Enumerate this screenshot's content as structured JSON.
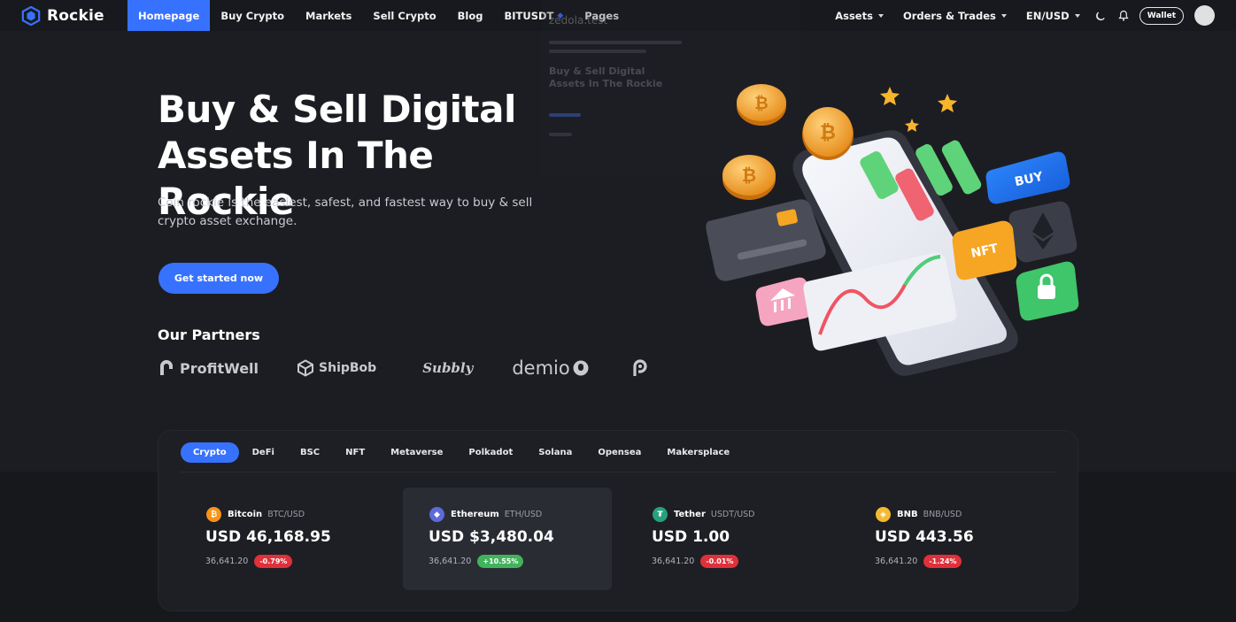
{
  "brand": {
    "name": "Rockie",
    "accent": "#3772ff"
  },
  "nav": {
    "links": [
      "Homepage",
      "Buy Crypto",
      "Markets",
      "Sell Crypto",
      "Blog",
      "BITUSDT",
      "Pages"
    ],
    "active": "Homepage",
    "right": {
      "assets": "Assets",
      "orders": "Orders & Trades",
      "locale": "EN/USD",
      "wallet": "Wallet"
    },
    "icons": [
      "moon-icon",
      "bell-icon",
      "avatar"
    ]
  },
  "background_overlay": {
    "line1": "zedola.test",
    "line2": "Buy & Sell Digital",
    "line3": "Assets In The Rockie"
  },
  "hero": {
    "title_line1": "Buy & Sell Digital",
    "title_line2": "Assets In The Rockie",
    "subtitle": "Coin rockie is the easiest, safest, and fastest way to buy & sell crypto asset exchange.",
    "cta": "Get started now",
    "illustration_labels": {
      "buy": "BUY",
      "nft": "NFT"
    }
  },
  "partners": {
    "title": "Our Partners",
    "items": [
      "ProfitWell",
      "ShipBob",
      "Subbly",
      "demio"
    ]
  },
  "market": {
    "tabs": [
      "Crypto",
      "DeFi",
      "BSC",
      "NFT",
      "Metaverse",
      "Polkadot",
      "Solana",
      "Opensea",
      "Makersplace"
    ],
    "active_tab": "Crypto",
    "coins": [
      {
        "name": "Bitcoin",
        "pair": "BTC/USD",
        "price": "USD 46,168.95",
        "volume": "36,641.20",
        "change": "-0.79%",
        "direction": "down",
        "icon_color": "#f7931a",
        "icon": "bitcoin-icon"
      },
      {
        "name": "Ethereum",
        "pair": "ETH/USD",
        "price": "USD $3,480.04",
        "volume": "36,641.20",
        "change": "+10.55%",
        "direction": "up",
        "icon_color": "#5f6ad9",
        "icon": "ethereum-icon"
      },
      {
        "name": "Tether",
        "pair": "USDT/USD",
        "price": "USD 1.00",
        "volume": "36,641.20",
        "change": "-0.01%",
        "direction": "down",
        "icon_color": "#26a17b",
        "icon": "tether-icon"
      },
      {
        "name": "BNB",
        "pair": "BNB/USD",
        "price": "USD 443.56",
        "volume": "36,641.20",
        "change": "-1.24%",
        "direction": "down",
        "icon_color": "#f3ba2f",
        "icon": "bnb-icon"
      }
    ]
  }
}
